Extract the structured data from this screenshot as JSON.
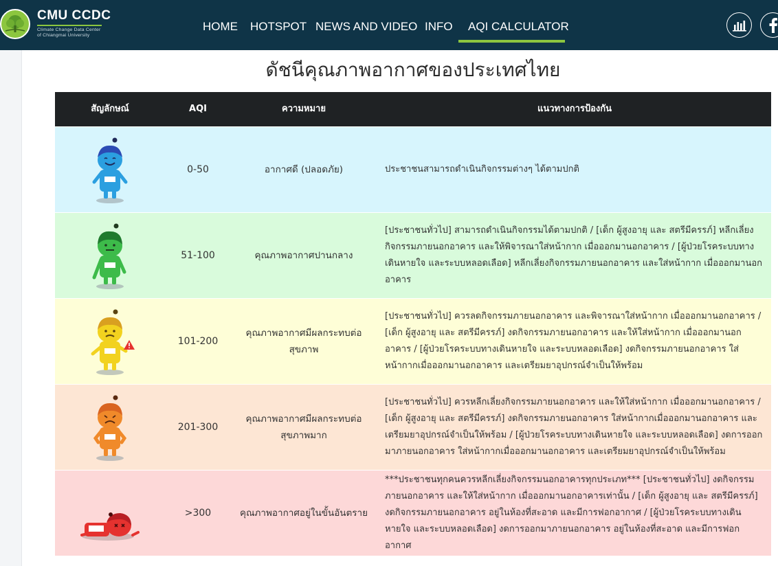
{
  "header": {
    "logo_title": "CMU CCDC",
    "logo_subtitle_line1": "Climate Change Data Center",
    "logo_subtitle_line2": "of Chiangmai University",
    "nav": [
      {
        "label": "HOME",
        "active": false
      },
      {
        "label": "HOTSPOT",
        "active": false
      },
      {
        "label": "NEWS AND VIDEO",
        "active": false
      },
      {
        "label": "INFO",
        "active": false
      },
      {
        "label": "AQI CALCULATOR",
        "active": true
      }
    ],
    "social_icons": [
      "bar-chart-icon",
      "facebook-icon"
    ]
  },
  "page": {
    "title": "ดัชนีคุณภาพอากาศของประเทศไทย"
  },
  "table": {
    "headers": {
      "symbol": "สัญลักษณ์",
      "aqi": "AQI",
      "meaning": "ความหมาย",
      "advice": "แนวทางการป้องกัน"
    },
    "rows": [
      {
        "color": "#d7f5fd",
        "icon": "mascot-good-icon",
        "icon_color": "#2b9fe0",
        "hair_color": "#2b4bb4",
        "aqi": "0-50",
        "meaning": "อากาศดี (ปลอดภัย)",
        "advice": "ประชาชนสามารถดำเนินกิจกรรมต่างๆ ได้ตามปกติ"
      },
      {
        "color": "#d9fbdc",
        "icon": "mascot-moderate-icon",
        "icon_color": "#3dbb4a",
        "hair_color": "#1f7a2e",
        "aqi": "51-100",
        "meaning": "คุณภาพอากาศปานกลาง",
        "advice": "[ประชาชนทั่วไป] สามารถดำเนินกิจกรรมได้ตามปกติ / [เด็ก ผู้สูงอายุ และ สตรีมีครรภ์] หลีกเลี่ยงกิจกรรมภายนอกอาคาร และให้พิจารณาใส่หน้ากาก เมื่อออกมานอกอาคาร / [ผู้ป่วยโรคระบบทางเดินหายใจ และระบบหลอดเลือด] หลีกเลี่ยงกิจกรรมภายนอกอาคาร และใส่หน้ากาก เมื่อออกมานอกอาคาร"
      },
      {
        "color": "#fefed7",
        "icon": "mascot-unhealthy-icon",
        "icon_color": "#f2d21f",
        "hair_color": "#d9a020",
        "aqi": "101-200",
        "meaning": "คุณภาพอากาศมีผลกระทบต่อสุขภาพ",
        "advice": "[ประชาชนทั่วไป] ควรลดกิจกรรมภายนอกอาคาร และพิจารณาใส่หน้ากาก เมื่อออกมานอกอาคาร / [เด็ก ผู้สูงอายุ และ สตรีมีครรภ์] งดกิจกรรมภายนอกอาคาร และให้ใส่หน้ากาก เมื่อออกมานอกอาคาร / [ผู้ป่วยโรคระบบทางเดินหายใจ และระบบหลอดเลือด] งดกิจกรรมภายนอกอาคาร ใส่หน้ากากเมื่อออกมานอกอาคาร และเตรียมยาอุปกรณ์จำเป็นให้พร้อม"
      },
      {
        "color": "#fde6d4",
        "icon": "mascot-very-unhealthy-icon",
        "icon_color": "#f08a2a",
        "hair_color": "#d96420",
        "aqi": "201-300",
        "meaning": "คุณภาพอากาศมีผลกระทบต่อสุขภาพมาก",
        "advice": "[ประชาชนทั่วไป] ควรหลีกเลี่ยงกิจกรรมภายนอกอาคาร และให้ใส่หน้ากาก เมื่อออกมานอกอาคาร / [เด็ก ผู้สูงอายุ และ สตรีมีครรภ์] งดกิจกรรมภายนอกอาคาร ใส่หน้ากากเมื่อออกมานอกอาคาร และเตรียมยาอุปกรณ์จำเป็นให้พร้อม / [ผู้ป่วยโรคระบบทางเดินหายใจ และระบบหลอดเลือด] งดการออกมาภายนอกอาคาร ใส่หน้ากากเมื่อออกมานอกอาคาร และเตรียมยาอุปกรณ์จำเป็นให้พร้อม"
      },
      {
        "color": "#fdd8d8",
        "icon": "mascot-hazardous-icon",
        "icon_color": "#e5322f",
        "hair_color": "#b81f24",
        "aqi": ">300",
        "meaning": "คุณภาพอากาศอยู่ในขั้นอันตราย",
        "advice": "***ประชาชนทุกคนควรหลีกเลี่ยงกิจกรรมนอกอาคารทุกประเภท*** [ประชาชนทั่วไป] งดกิจกรรมภายนอกอาคาร และให้ใส่หน้ากาก เมื่อออกมานอกอาคารเท่านั้น / [เด็ก ผู้สูงอายุ และ สตรีมีครรภ์] งดกิจกรรมภายนอกอาคาร อยู่ในห้องที่สะอาด และมีการฟอกอากาศ / [ผู้ป่วยโรคระบบทางเดินหายใจ และระบบหลอดเลือด] งดการออกมาภายนอกอาคาร อยู่ในห้องที่สะอาด และมีการฟอกอากาศ"
      }
    ]
  }
}
